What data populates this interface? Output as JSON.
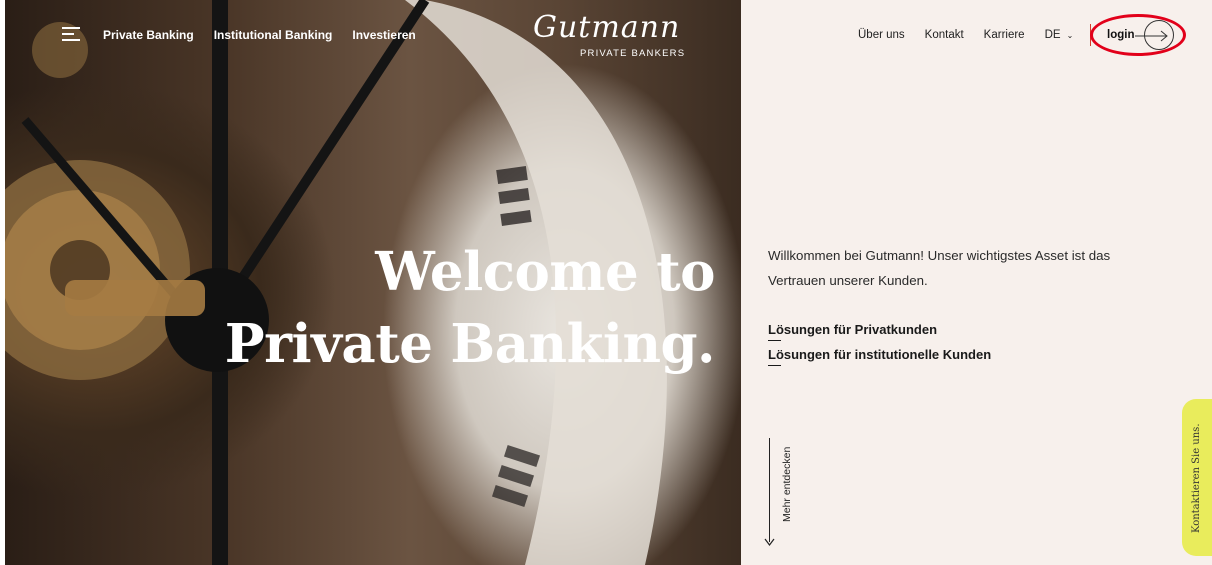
{
  "nav": {
    "left_items": [
      "Private Banking",
      "Institutional Banking",
      "Investieren"
    ],
    "right_items": [
      "Über uns",
      "Kontakt",
      "Karriere"
    ],
    "language": "DE",
    "login_label": "login"
  },
  "logo": {
    "script": "Gutmann",
    "subtitle": "PRIVATE BANKERS"
  },
  "hero": {
    "title_line1": "Welcome to",
    "title_line2": "Private Banking."
  },
  "intro": {
    "text": "Willkommen bei Gutmann! Unser wichtigstes Asset ist das Vertrauen unserer Kunden.",
    "links": [
      "Lösungen für Privatkunden",
      "Lösungen für institutionelle Kunden"
    ]
  },
  "scroll_label": "Mehr entdecken",
  "contact_tab": "Kontaktieren Sie uns.",
  "colors": {
    "panel_bg": "#f7f0ec",
    "contact_tab_bg": "#e9ec5c",
    "highlight": "#e2001a"
  }
}
